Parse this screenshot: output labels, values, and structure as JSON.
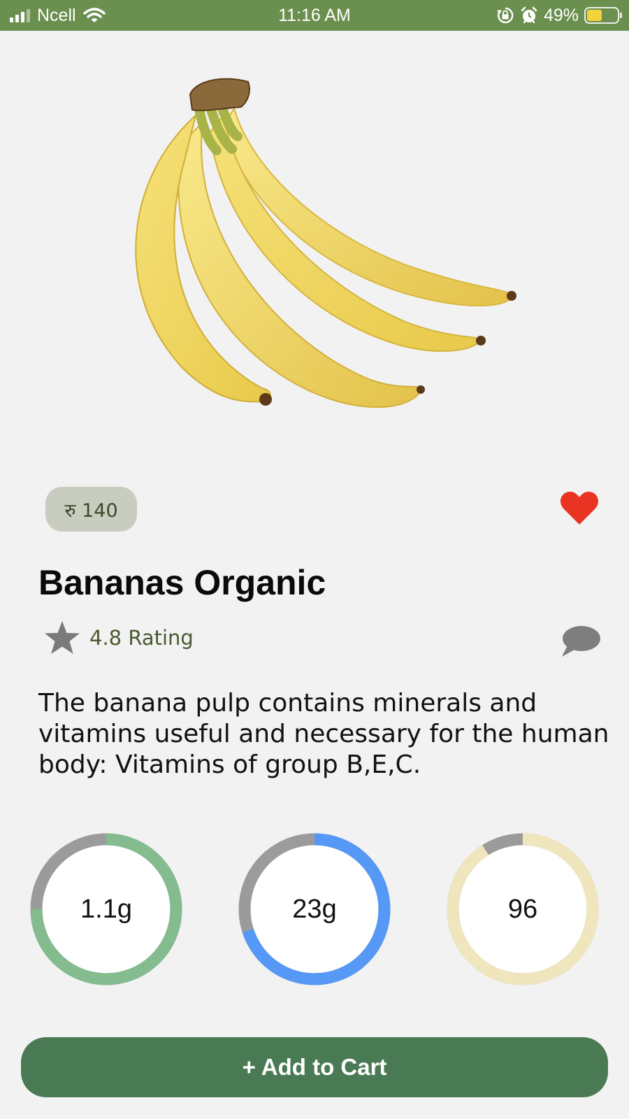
{
  "status_bar": {
    "carrier": "Ncell",
    "time": "11:16 AM",
    "battery_percent": "49%",
    "battery_level": 0.49,
    "icons": [
      "signal-icon",
      "wifi-icon",
      "orientation-lock-icon",
      "alarm-icon",
      "battery-icon"
    ]
  },
  "product": {
    "image_icon": "banana-bunch-image",
    "price": "रु 140",
    "favorite_icon": "heart-icon",
    "favorited": true,
    "name": "Bananas Organic",
    "rating_icon": "star-icon",
    "rating": "4.8 Rating",
    "comment_icon": "speech-bubble-icon",
    "description": "The banana pulp contains minerals and vitamins useful and necessary for the human body: Vitamins of group B,E,C."
  },
  "nutrients": [
    {
      "value": "1.1g",
      "fill": 0.75,
      "color": "#84bb8f"
    },
    {
      "value": "23g",
      "fill": 0.7,
      "color": "#5598f5"
    },
    {
      "value": "96",
      "fill": 0.91,
      "color": "#f0e6bd"
    }
  ],
  "colors": {
    "status_bar": "#6a8f4e",
    "accent": "#4a7a54",
    "heart": "#e93323",
    "ring_track": "#9b9b9b"
  },
  "cart_button": {
    "label": "+ Add to Cart"
  }
}
